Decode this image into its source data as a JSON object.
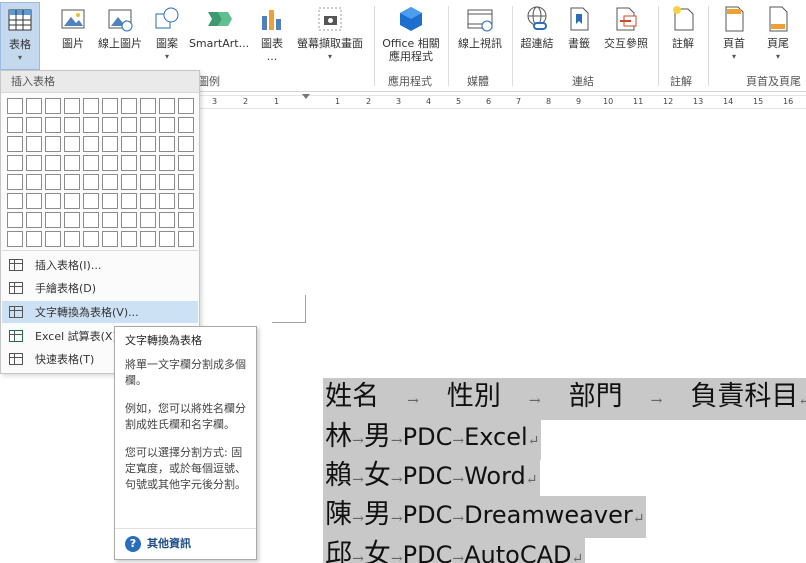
{
  "ribbon": {
    "buttons": [
      {
        "label": "表格",
        "caret": "▾",
        "icon": "table-icon"
      },
      {
        "label": "圖片",
        "icon": "picture-icon"
      },
      {
        "label": "線上圖片",
        "icon": "online-picture-icon"
      },
      {
        "label": "圖案",
        "caret": "▾",
        "icon": "shapes-icon"
      },
      {
        "label": "SmartArt...",
        "icon": "smartart-icon"
      },
      {
        "label": "圖表",
        "sub": "...",
        "icon": "chart-icon"
      },
      {
        "label": "螢幕擷取畫面",
        "caret": "▾",
        "icon": "screenshot-icon"
      },
      {
        "label": "Office 相關",
        "sub": "應用程式",
        "caret": "▾",
        "icon": "office-apps-icon"
      },
      {
        "label": "線上視訊",
        "icon": "online-video-icon"
      },
      {
        "label": "超連結",
        "icon": "hyperlink-icon"
      },
      {
        "label": "書籤",
        "icon": "bookmark-icon"
      },
      {
        "label": "交互參照",
        "icon": "cross-reference-icon"
      },
      {
        "label": "註解",
        "icon": "comment-icon"
      },
      {
        "label": "頁首",
        "caret": "▾",
        "icon": "header-icon"
      },
      {
        "label": "頁尾",
        "caret": "▾",
        "icon": "footer-icon"
      }
    ],
    "groups": {
      "illustrations": "圖例",
      "apps": "應用程式",
      "media": "媒體",
      "links": "連結",
      "comments": "註解",
      "header_footer": "頁首及頁尾"
    }
  },
  "ruler": {
    "left_ticks": [
      "3",
      "2",
      "1"
    ],
    "right_ticks": [
      "1",
      "2",
      "3",
      "4",
      "5",
      "6",
      "7",
      "8",
      "9",
      "10",
      "11",
      "12",
      "13",
      "14",
      "15",
      "16"
    ]
  },
  "table_menu": {
    "header": "插入表格",
    "grid": {
      "rows": 8,
      "cols": 10
    },
    "items": [
      {
        "label": "插入表格(I)...",
        "icon": "insert-table-icon"
      },
      {
        "label": "手繪表格(D)",
        "icon": "draw-table-icon"
      },
      {
        "label": "文字轉換為表格(V)...",
        "icon": "convert-text-icon"
      },
      {
        "label": "Excel 試算表(X)",
        "icon": "excel-icon"
      },
      {
        "label": "快速表格(T)",
        "icon": "quick-table-icon"
      }
    ]
  },
  "tooltip": {
    "title": "文字轉換為表格",
    "para1": "將單一文字欄分割成多個欄。",
    "para2": "例如，您可以將姓名欄分割成姓氏欄和名字欄。",
    "para3": "您可以選擇分割方式: 固定寬度，或於每個逗號、句號或其他字元後分割。",
    "help": "其他資訊"
  },
  "document": {
    "lines": [
      {
        "cells": [
          "姓名",
          "性別",
          "部門",
          "負責科目"
        ]
      },
      {
        "cells": [
          "林",
          "男",
          "PDC",
          "Excel"
        ]
      },
      {
        "cells": [
          "賴",
          "女",
          "PDC",
          "Word"
        ]
      },
      {
        "cells": [
          "陳",
          "男",
          "PDC",
          "Dreamweaver"
        ]
      },
      {
        "cells": [
          "邱",
          "女",
          "PDC",
          "AutoCAD"
        ]
      }
    ],
    "tab_mark": "→",
    "para_mark": "↵"
  },
  "colors": {
    "selection": "#c8c8c8",
    "ribbon_active": "#c5d9ee",
    "menu_hover": "#cde1f5",
    "help_blue": "#2a6ebb"
  }
}
